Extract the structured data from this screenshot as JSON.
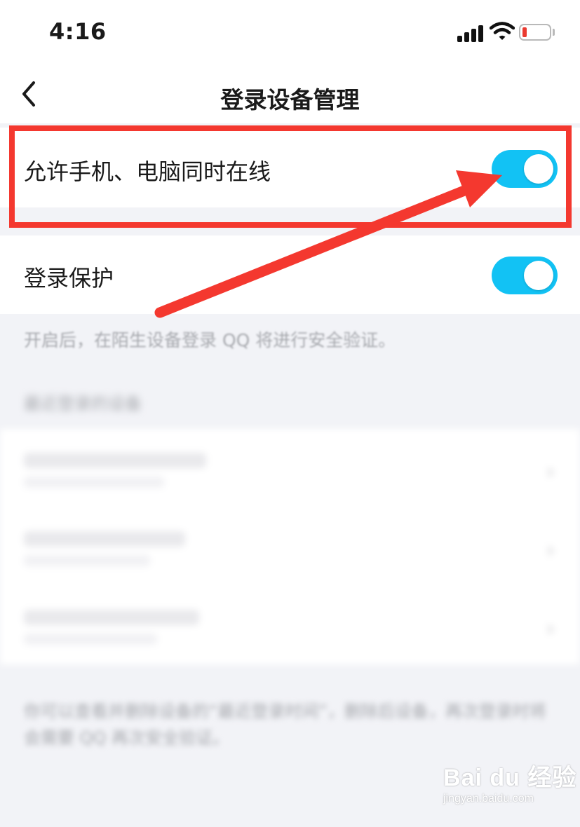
{
  "status_bar": {
    "time": "4:16",
    "battery_color": "#ea3a30"
  },
  "header": {
    "title": "登录设备管理",
    "back_icon": "chevron-left-icon"
  },
  "settings": {
    "simultaneous_online": {
      "label": "允许手机、电脑同时在线",
      "enabled": true
    },
    "login_protection": {
      "label": "登录保护",
      "enabled": true,
      "description": "开启后，在陌生设备登录 QQ 将进行安全验证。"
    }
  },
  "recent_devices": {
    "section_header": "最近登录的设备"
  },
  "footer_note": "你可以查看并删除设备的“最近登录时间”，删除后设备，再次登录时将会需要 QQ 再次安全验证。",
  "watermark": {
    "brand": "Bai du 经验",
    "url": "jingyan.baidu.com"
  },
  "accent_color": "#12c2f4",
  "annotation_color": "#f4382f"
}
